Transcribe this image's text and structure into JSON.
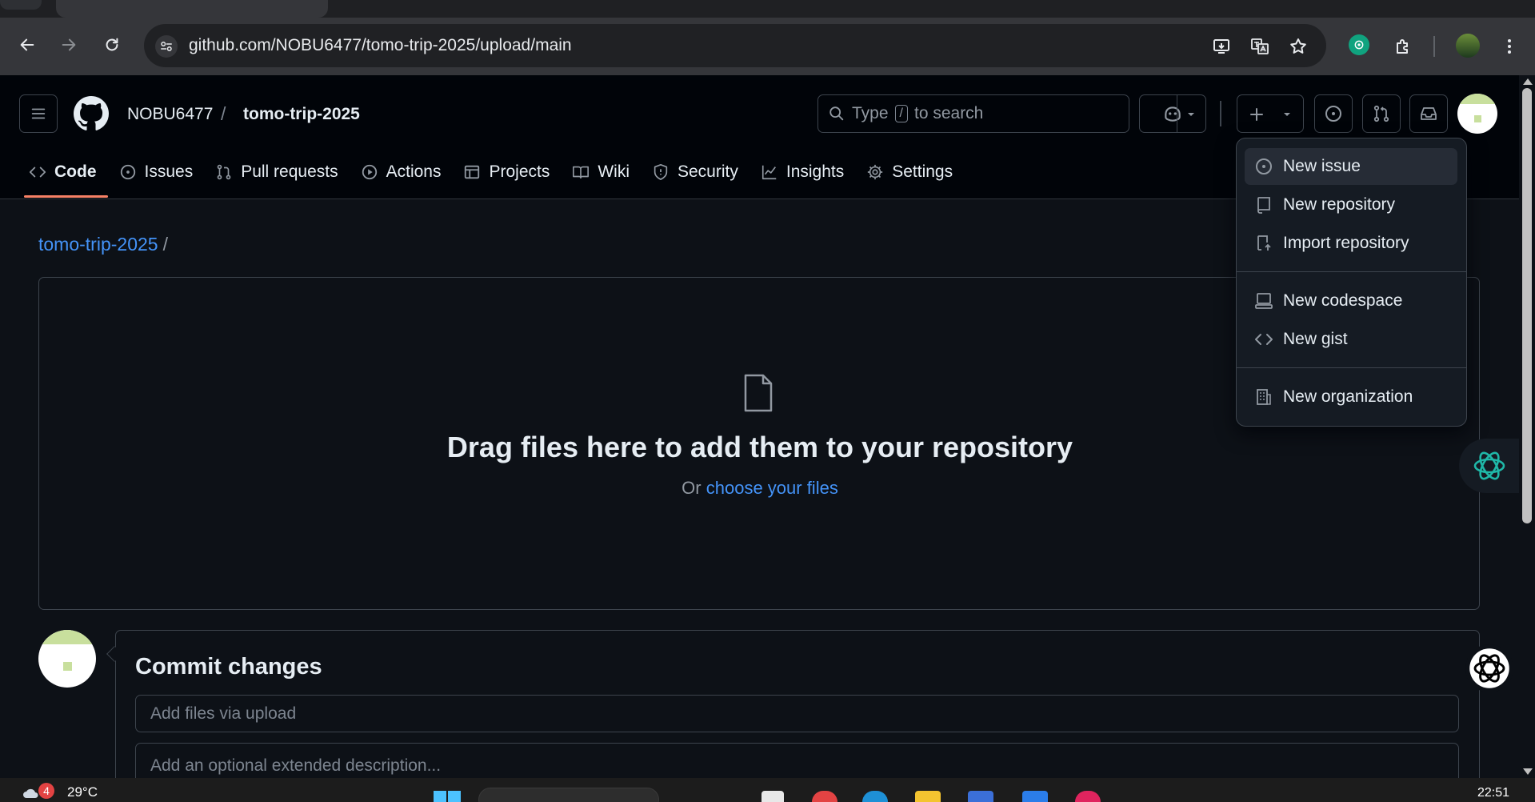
{
  "browser": {
    "url": "github.com/NOBU6477/tomo-trip-2025/upload/main",
    "icons": [
      "back-icon",
      "forward-icon",
      "reload-icon",
      "site-settings-icon",
      "install-app-icon",
      "translate-icon",
      "bookmark-star-icon",
      "chatgpt-extension-icon",
      "extensions-puzzle-icon",
      "profile-avatar",
      "menu-kebab-icon"
    ]
  },
  "header": {
    "owner": "NOBU6477",
    "separator": "/",
    "repo": "tomo-trip-2025",
    "search_prefix": "Type",
    "search_key": "/",
    "search_suffix": "to search"
  },
  "repo_nav": [
    {
      "label": "Code",
      "icon": "code-icon"
    },
    {
      "label": "Issues",
      "icon": "issue-icon"
    },
    {
      "label": "Pull requests",
      "icon": "pull-request-icon"
    },
    {
      "label": "Actions",
      "icon": "play-icon"
    },
    {
      "label": "Projects",
      "icon": "table-icon"
    },
    {
      "label": "Wiki",
      "icon": "book-icon"
    },
    {
      "label": "Security",
      "icon": "shield-icon"
    },
    {
      "label": "Insights",
      "icon": "graph-icon"
    },
    {
      "label": "Settings",
      "icon": "gear-icon"
    }
  ],
  "breadcrumb": {
    "repo_link": "tomo-trip-2025",
    "separator": "/"
  },
  "upload": {
    "title": "Drag files here to add them to your repository",
    "prefix": "Or",
    "link": "choose your files"
  },
  "commit": {
    "title": "Commit changes",
    "summary_placeholder": "Add files via upload",
    "description_placeholder": "Add an optional extended description..."
  },
  "create_menu": {
    "items": [
      {
        "label": "New issue",
        "icon": "issue-icon"
      },
      {
        "label": "New repository",
        "icon": "repo-icon"
      },
      {
        "label": "Import repository",
        "icon": "repo-push-icon"
      },
      {
        "label": "New codespace",
        "icon": "codespaces-icon"
      },
      {
        "label": "New gist",
        "icon": "code-icon"
      },
      {
        "label": "New organization",
        "icon": "organization-icon"
      }
    ]
  },
  "taskbar": {
    "weather_badge": "4",
    "temperature": "29°C",
    "time": "22:51"
  },
  "colors": {
    "accent_link": "#4493f8",
    "active_tab_underline": "#f78166",
    "background": "#0d1117",
    "header_background": "#010409"
  }
}
